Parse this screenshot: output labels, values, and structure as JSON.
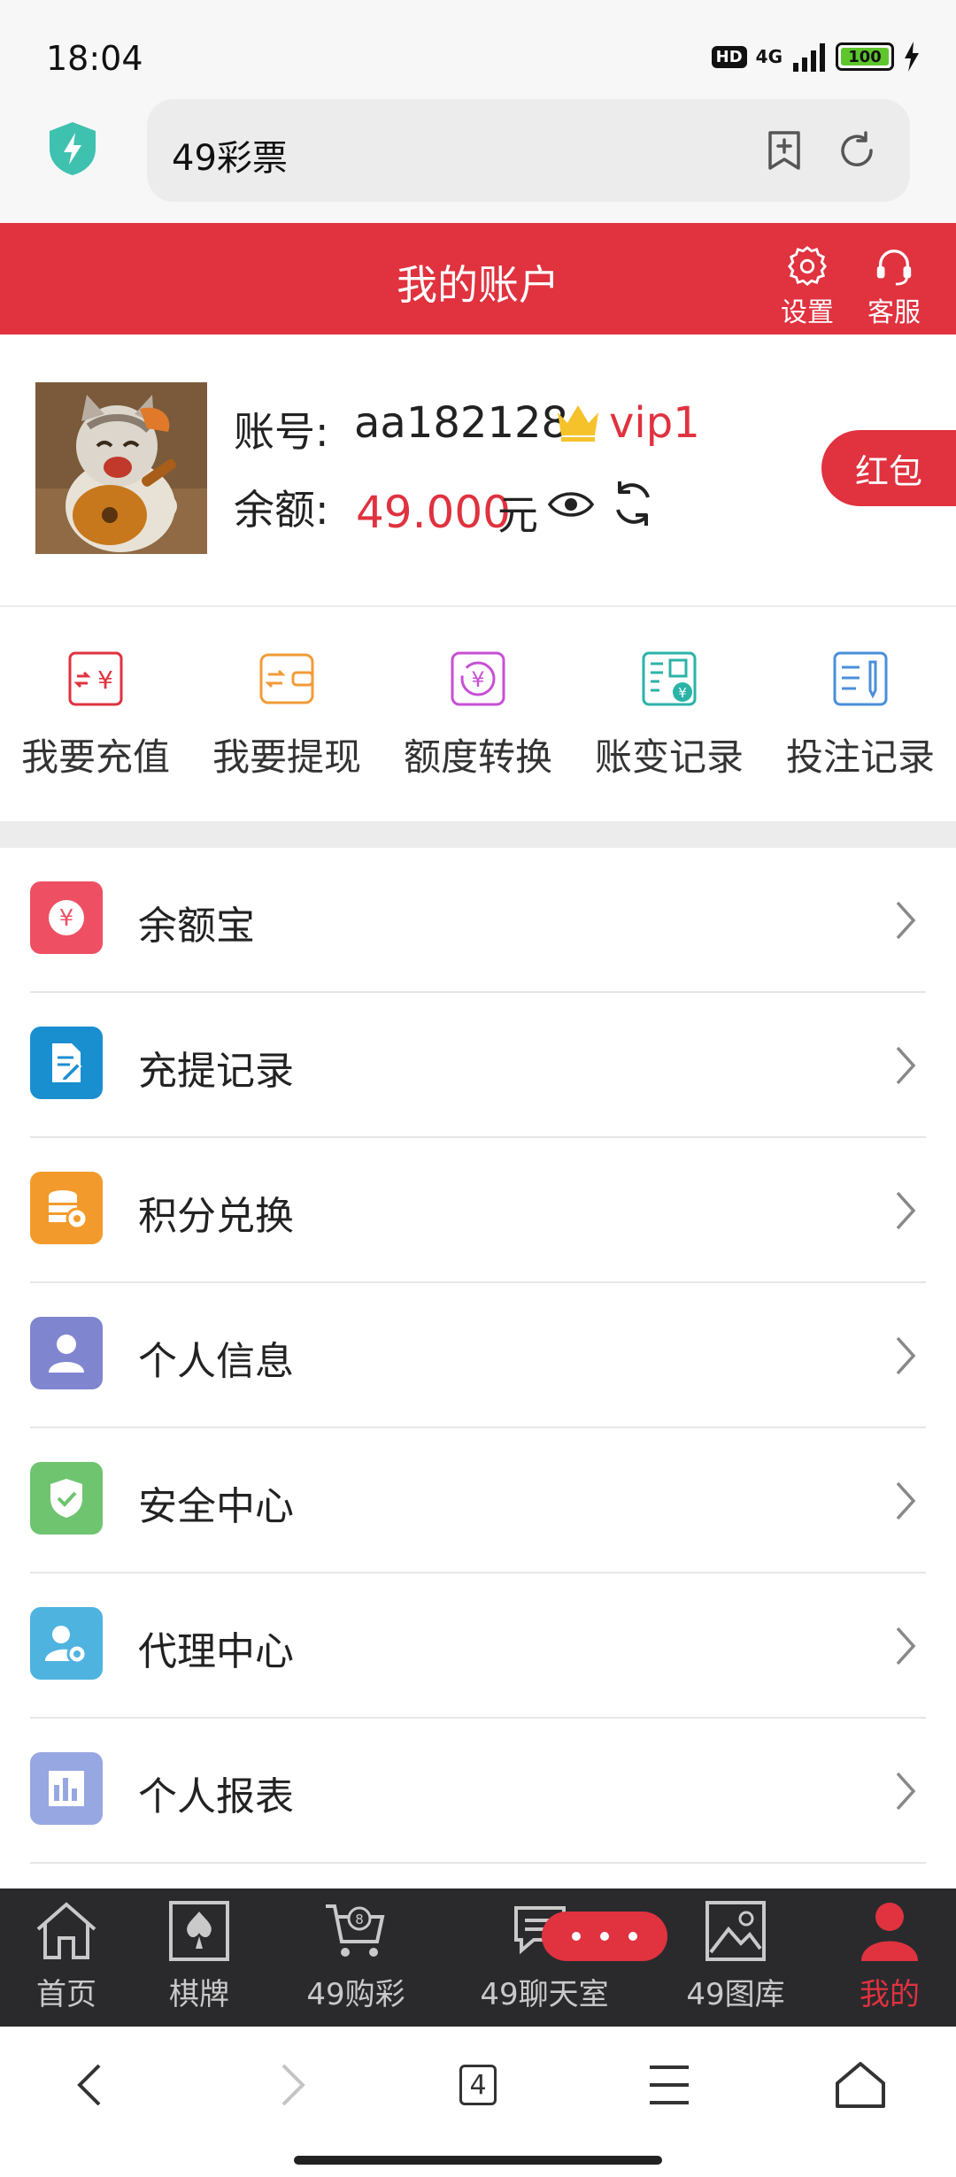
{
  "status_bar": {
    "time": "18:04",
    "hd": "HD",
    "network": "4G",
    "battery": "100"
  },
  "browser": {
    "url": "49彩票"
  },
  "header": {
    "title": "我的账户",
    "settings_label": "设置",
    "service_label": "客服"
  },
  "account": {
    "account_label": "账号:",
    "username": "aa182128",
    "vip": "vip1",
    "balance_label": "余额:",
    "balance": "49.000",
    "unit": "元",
    "red_packet": "红包"
  },
  "quick_actions": [
    {
      "label": "我要充值",
      "icon": "recharge-icon",
      "color": "#e0323f"
    },
    {
      "label": "我要提现",
      "icon": "withdraw-icon",
      "color": "#f29b38"
    },
    {
      "label": "额度转换",
      "icon": "transfer-icon",
      "color": "#c84fd6"
    },
    {
      "label": "账变记录",
      "icon": "account-change-icon",
      "color": "#2bb3a8"
    },
    {
      "label": "投注记录",
      "icon": "bet-record-icon",
      "color": "#4a8fd9"
    }
  ],
  "menu": [
    {
      "label": "余额宝",
      "icon": "yuebao-icon",
      "color": "#ee4f63"
    },
    {
      "label": "充提记录",
      "icon": "document-edit-icon",
      "color": "#1a8fd0"
    },
    {
      "label": "积分兑换",
      "icon": "coins-icon",
      "color": "#f29b2c"
    },
    {
      "label": "个人信息",
      "icon": "user-icon",
      "color": "#7f85cf"
    },
    {
      "label": "安全中心",
      "icon": "shield-check-icon",
      "color": "#6fc46f"
    },
    {
      "label": "代理中心",
      "icon": "agent-gear-icon",
      "color": "#4fb3e0"
    },
    {
      "label": "个人报表",
      "icon": "bar-chart-icon",
      "color": "#97a7e2"
    }
  ],
  "tabs": [
    {
      "label": "首页",
      "icon": "home-icon"
    },
    {
      "label": "棋牌",
      "icon": "spade-card-icon"
    },
    {
      "label": "49购彩",
      "icon": "cart-icon"
    },
    {
      "label": "49聊天室",
      "icon": "chat-icon"
    },
    {
      "label": "49图库",
      "icon": "gallery-icon"
    },
    {
      "label": "我的",
      "icon": "profile-icon",
      "active": true,
      "active_color": "#e0323f"
    }
  ],
  "system_nav": {
    "tab_count": "4"
  }
}
